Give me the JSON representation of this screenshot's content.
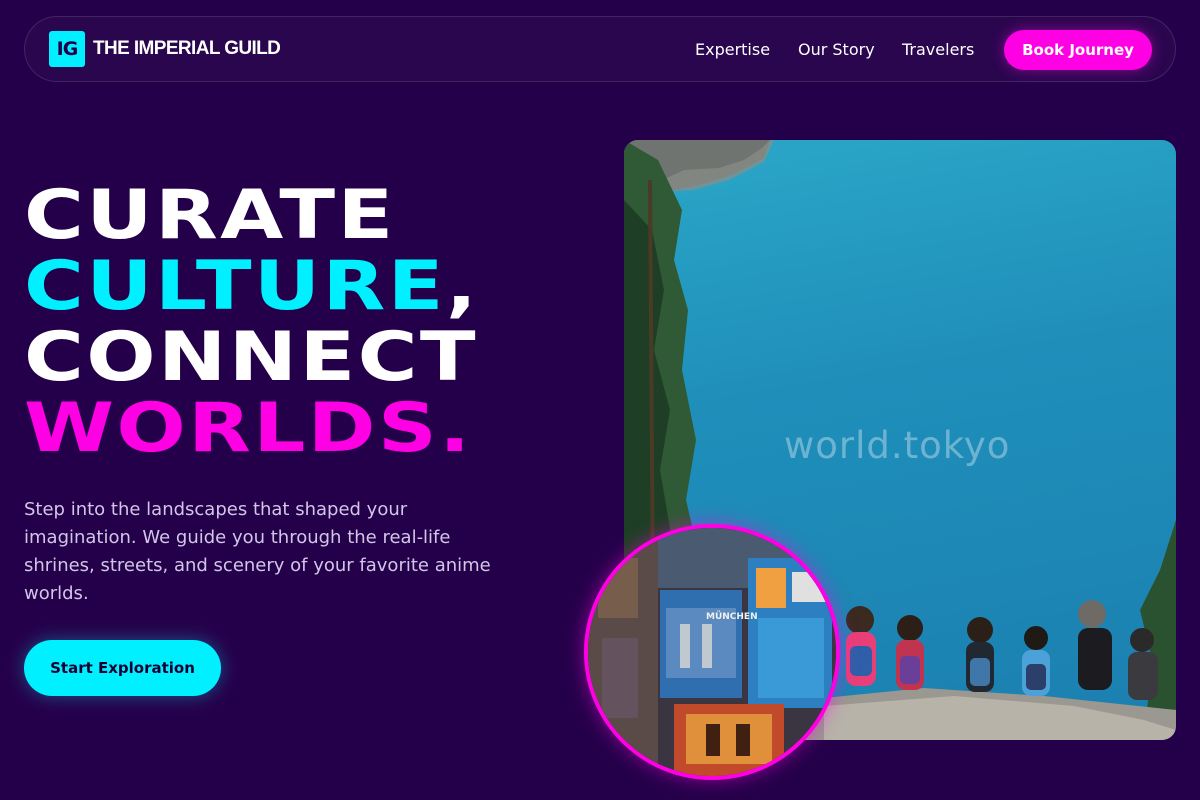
{
  "brand": {
    "badge": "IG",
    "name": "THE IMPERIAL GUILD"
  },
  "nav": {
    "links": [
      "Expertise",
      "Our Story",
      "Travelers"
    ],
    "cta": "Book Journey"
  },
  "hero": {
    "headline": {
      "line1": "CURATE",
      "line2_word": "CULTURE",
      "line2_punct": ",",
      "line3": "CONNECT",
      "line4": "WORLDS."
    },
    "subtitle": "Step into the landscapes that shaped your imagination. We guide you through the real-life shrines, streets, and scenery of your favorite anime worlds.",
    "cta": "Start Exploration",
    "main_image": {
      "watermark": "world.tokyo"
    },
    "circle_image": {
      "postcard_label": "MÜNCHEN"
    }
  },
  "colors": {
    "background": "#25004a",
    "accent_cyan": "#00f0ff",
    "accent_magenta": "#ff00e5",
    "text_primary": "#ffffff",
    "text_muted": "#d2c6e8"
  }
}
